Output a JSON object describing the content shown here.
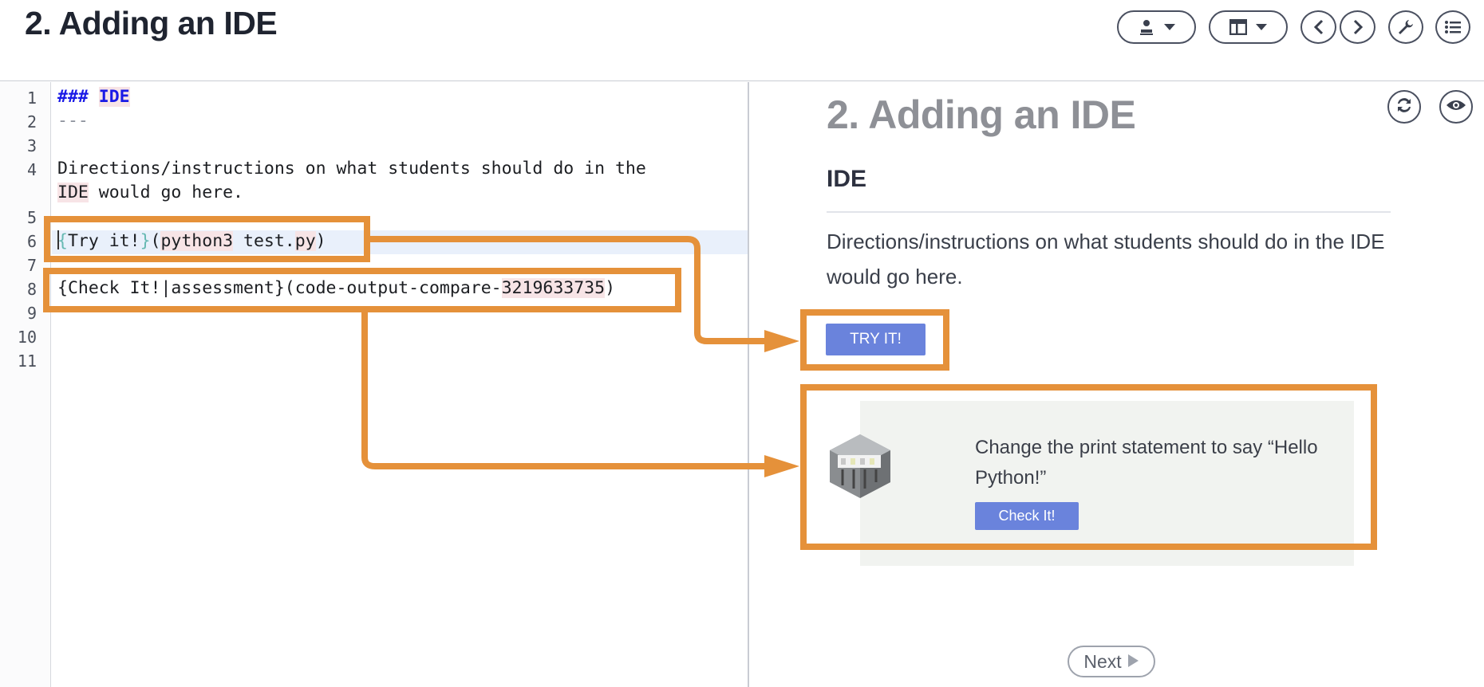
{
  "header": {
    "title": "2. Adding an IDE",
    "buttons": [
      {
        "name": "student-view-button",
        "icon": "user-icon"
      },
      {
        "name": "layout-button",
        "icon": "layout-icon"
      },
      {
        "name": "prev-button",
        "icon": "chevron-left-icon"
      },
      {
        "name": "next-page-button",
        "icon": "chevron-right-icon"
      },
      {
        "name": "settings-button",
        "icon": "wrench-icon"
      },
      {
        "name": "outline-button",
        "icon": "list-icon"
      }
    ]
  },
  "editor": {
    "line_numbers": [
      "1",
      "2",
      "3",
      "4",
      "5",
      "6",
      "7",
      "8",
      "9",
      "10",
      "11"
    ],
    "line1": {
      "hashes": "###",
      "word": "IDE"
    },
    "line2": "---",
    "line4a": "Directions/instructions on what students should do in the",
    "line4b_hl": "IDE",
    "line4b_rest": " would go here.",
    "line6": {
      "open": "{",
      "label": "Try it!",
      "close": "}",
      "paren_open": "(",
      "cmd": "python3",
      "space": " test.",
      "ext": "py",
      "paren_close": ")"
    },
    "line8": {
      "prefix": "{Check It!|assessment}(code-output-compare-",
      "id": "3219633735",
      "suffix": ")"
    }
  },
  "preview": {
    "title": "2. Adding an IDE",
    "heading": "IDE",
    "paragraph": "Directions/instructions on what students should do in the IDE would go here.",
    "try_button": "TRY IT!",
    "assessment_text": "Change the print statement to say “Hello Python!”",
    "check_button": "Check It!",
    "next_button": "Next",
    "icons": [
      "refresh-icon",
      "eye-icon"
    ]
  },
  "colors": {
    "annotation_orange": "#e5913a",
    "button_blue": "#6a83dc",
    "active_line": "#e9f0fb"
  }
}
